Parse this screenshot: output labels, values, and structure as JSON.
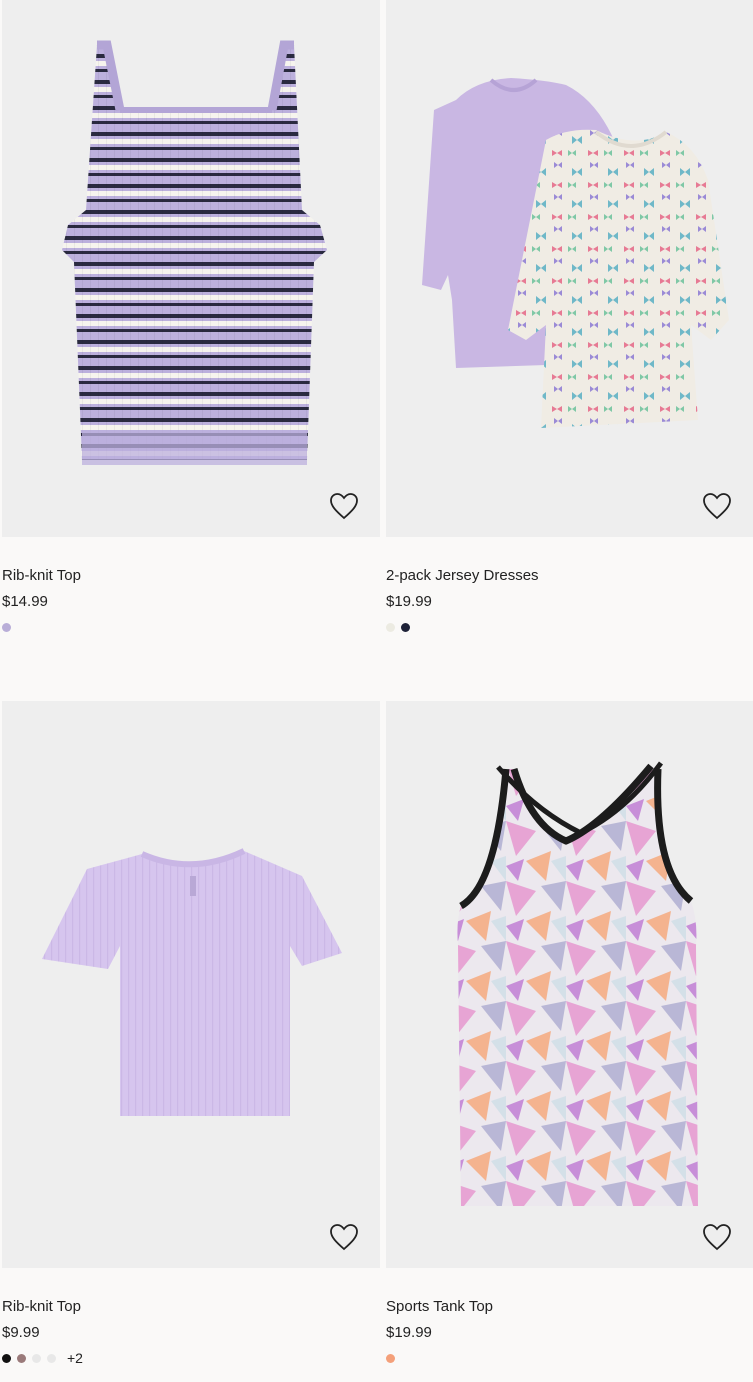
{
  "products": [
    {
      "title": "Rib-knit Top",
      "price": "$14.99",
      "swatches": [
        "#b9aed8"
      ],
      "more": "",
      "image": "striped-tank-top"
    },
    {
      "title": "2-pack Jersey Dresses",
      "price": "$19.99",
      "swatches": [
        "#ecebe2",
        "#1e2238"
      ],
      "more": "",
      "image": "jersey-dresses"
    },
    {
      "title": "Rib-knit Top",
      "price": "$9.99",
      "swatches": [
        "#111111",
        "#9a7a7a",
        "#e8e8e8",
        "#e8e8e8"
      ],
      "more": "+2",
      "image": "lilac-tshirt"
    },
    {
      "title": "Sports Tank Top",
      "price": "$19.99",
      "swatches": [
        "#f4a07a"
      ],
      "more": "",
      "image": "sports-tank"
    }
  ],
  "icons": {
    "favorite": "heart-icon"
  }
}
